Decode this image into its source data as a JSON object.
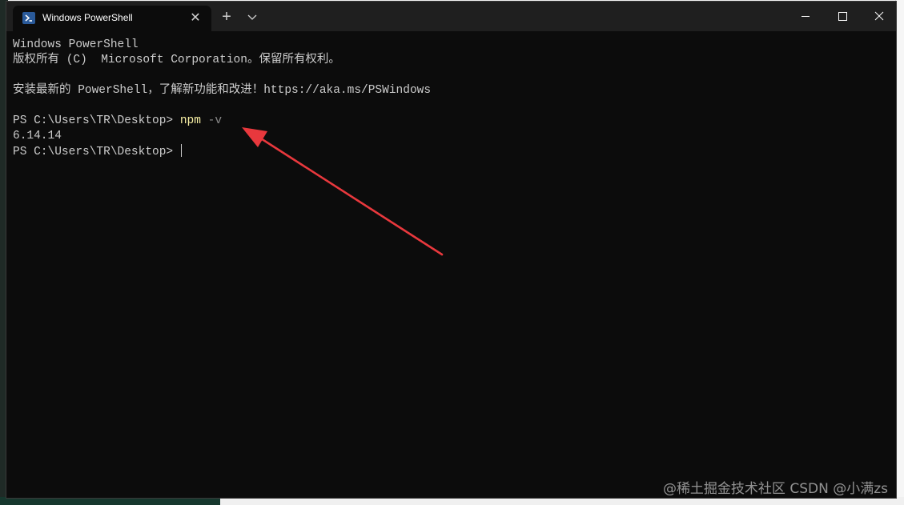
{
  "window": {
    "tab_title": "Windows PowerShell",
    "tab_close": "✕",
    "new_tab": "+"
  },
  "console": {
    "line1": "Windows PowerShell",
    "line2": "版权所有 (C)  Microsoft Corporation。保留所有权利。",
    "line3": "安装最新的 PowerShell，了解新功能和改进！https://aka.ms/PSWindows",
    "prompt1": "PS C:\\Users\\TR\\Desktop> ",
    "command": "npm",
    "argument": " -v",
    "output": "6.14.14",
    "prompt2": "PS C:\\Users\\TR\\Desktop> "
  },
  "watermark": "@稀土掘金技术社区 CSDN @小满zs",
  "colors": {
    "terminal_bg": "#0c0c0c",
    "titlebar_bg": "#1f1f1f",
    "text": "#cccccc",
    "command": "#f9f1a5",
    "annotation_arrow": "#e8383d"
  },
  "icons": {
    "tab": "powershell-icon",
    "close": "close-icon",
    "new_tab": "plus-icon",
    "dropdown": "chevron-down-icon",
    "minimize": "minimize-icon",
    "maximize": "maximize-icon",
    "window_close": "close-icon"
  }
}
